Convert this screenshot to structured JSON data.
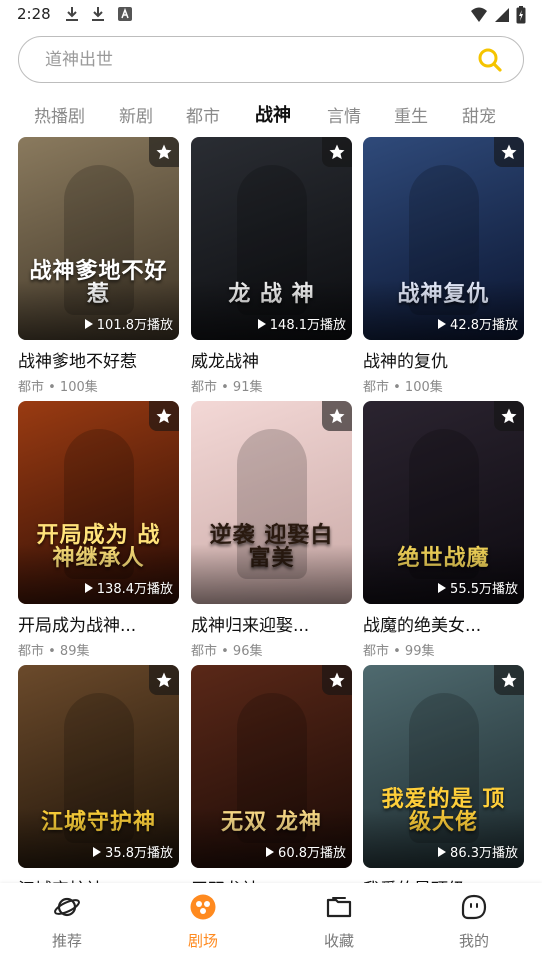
{
  "status_bar": {
    "time": "2:28"
  },
  "search": {
    "placeholder": "道神出世"
  },
  "tabs": [
    {
      "label": "热播剧"
    },
    {
      "label": "新剧"
    },
    {
      "label": "都市"
    },
    {
      "label": "战神",
      "active": true
    },
    {
      "label": "言情"
    },
    {
      "label": "重生"
    },
    {
      "label": "甜宠"
    }
  ],
  "cards": [
    {
      "title": "战神爹地不好惹",
      "meta": "都市 • 100集",
      "plays": "101.8万播放",
      "poster_text": "战神爹地不好惹",
      "colors": [
        "#8a7a5e",
        "#3d3325"
      ],
      "text_color": "#ffffff"
    },
    {
      "title": "威龙战神",
      "meta": "都市 • 91集",
      "plays": "148.1万播放",
      "poster_text": "龙 战 神",
      "colors": [
        "#2a2d33",
        "#0c0d10"
      ],
      "text_color": "#f2f2f2"
    },
    {
      "title": "战神的复仇",
      "meta": "都市 • 100集",
      "plays": "42.8万播放",
      "poster_text": "战神复仇",
      "colors": [
        "#2f4a7a",
        "#0b1530"
      ],
      "text_color": "#e8eeff"
    },
    {
      "title": "开局成为战神...",
      "meta": "都市 • 89集",
      "plays": "138.4万播放",
      "poster_text": "开局成为 战神继承人",
      "colors": [
        "#9a3b12",
        "#2a0c05"
      ],
      "text_color": "#ffe27a"
    },
    {
      "title": "成神归来迎娶...",
      "meta": "都市 • 96集",
      "plays": "",
      "poster_text": "逆袭 迎娶白富美",
      "colors": [
        "#f3d8d6",
        "#c9a9a6"
      ],
      "text_color": "#2a1a10"
    },
    {
      "title": "战魔的绝美女...",
      "meta": "都市 • 99集",
      "plays": "55.5万播放",
      "poster_text": "绝世战魔",
      "colors": [
        "#2b2430",
        "#0d0a10"
      ],
      "text_color": "#f5d75a"
    },
    {
      "title": "江城守护神",
      "meta": "",
      "plays": "35.8万播放",
      "poster_text": "江城守护神",
      "colors": [
        "#6b4a2b",
        "#1c1208"
      ],
      "text_color": "#ffd23a"
    },
    {
      "title": "无双龙神",
      "meta": "",
      "plays": "60.8万播放",
      "poster_text": "无双 龙神",
      "colors": [
        "#5a2818",
        "#1a0a06"
      ],
      "text_color": "#ffdf8a"
    },
    {
      "title": "我爱的是顶级",
      "meta": "",
      "plays": "86.3万播放",
      "poster_text": "我爱的是 顶级大佬",
      "colors": [
        "#4f6a6f",
        "#1d2b2f"
      ],
      "text_color": "#ffcf3a"
    }
  ],
  "bottom_nav": [
    {
      "label": "推荐",
      "icon": "planet-icon"
    },
    {
      "label": "剧场",
      "icon": "theater-icon",
      "active": true
    },
    {
      "label": "收藏",
      "icon": "folder-icon"
    },
    {
      "label": "我的",
      "icon": "profile-icon"
    }
  ],
  "colors": {
    "accent": "#ff8a1f",
    "search_icon": "#f5c400"
  }
}
